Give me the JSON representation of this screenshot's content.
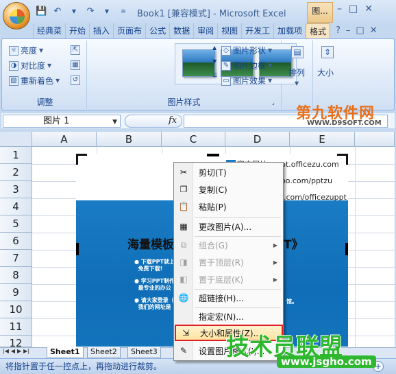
{
  "window": {
    "title": "Book1 [兼容模式] - Microsoft Excel",
    "context_tab_title": "图...",
    "window_buttons": [
      "–",
      "□",
      "✕"
    ]
  },
  "qat": {
    "icons": [
      "save-icon",
      "undo-icon",
      "redo-icon",
      "customize-icon"
    ]
  },
  "ribbon": {
    "tabs": [
      "经典菜",
      "开始",
      "插入",
      "页面布",
      "公式",
      "数据",
      "审阅",
      "视图",
      "开发工",
      "加载项",
      "格式"
    ],
    "active_tab": "格式",
    "help_icons": [
      "?",
      "–",
      "□",
      "✕"
    ],
    "groups": {
      "adjust": {
        "label": "调整",
        "brightness": "亮度",
        "contrast": "对比度",
        "recolor": "重新着色"
      },
      "picture_styles": {
        "label": "图片样式",
        "shape": "图片形状",
        "border": "图片边框",
        "effects": "图片效果"
      },
      "arrange": {
        "label": "排列"
      },
      "size": {
        "label": "大小"
      }
    }
  },
  "watermark_top": {
    "title": "第九软件网",
    "url": "WWW.D9SOFT.COM"
  },
  "formula_bar": {
    "name_box": "图片 1",
    "fx": "fx",
    "value": ""
  },
  "sheet": {
    "columns": [
      "A",
      "B",
      "C",
      "D",
      "E"
    ],
    "rows": [
      "1",
      "2",
      "3",
      "4",
      "5",
      "6",
      "7",
      "8",
      "9",
      "10",
      "11",
      "12"
    ]
  },
  "picture": {
    "top_lines": [
      "ppt.officezu.com",
      "eibo.com/pptzu",
      "qq.com/officezuppt"
    ],
    "top_line_prefix": "官方网址：",
    "heading_left": "海量模板",
    "heading_right": "T》",
    "bullets": [
      {
        "line1": "下载PPT就上",
        "line2": "免费下载!"
      },
      {
        "line1": "学习PPT制作",
        "line2": "最专业的办公"
      },
      {
        "line1": "请大家登录（",
        "line2": "我们的网址是"
      }
    ],
    "bullet_tail": "馆。"
  },
  "context_menu": {
    "items": [
      {
        "label": "剪切(T)",
        "icon": "scissors-icon",
        "glyph": "✂",
        "enabled": true
      },
      {
        "label": "复制(C)",
        "icon": "copy-icon",
        "glyph": "❐",
        "enabled": true
      },
      {
        "label": "粘贴(P)",
        "icon": "paste-icon",
        "glyph": "📋",
        "enabled": true
      },
      {
        "label": "更改图片(A)...",
        "icon": "change-picture-icon",
        "glyph": "▦",
        "enabled": true
      },
      {
        "label": "组合(G)",
        "icon": "group-icon",
        "glyph": "⧉",
        "enabled": false,
        "submenu": true
      },
      {
        "label": "置于顶层(R)",
        "icon": "bring-front-icon",
        "glyph": "◨",
        "enabled": false,
        "submenu": true
      },
      {
        "label": "置于底层(K)",
        "icon": "send-back-icon",
        "glyph": "◧",
        "enabled": false,
        "submenu": true
      },
      {
        "label": "超链接(H)...",
        "icon": "hyperlink-icon",
        "glyph": "🌐",
        "enabled": true
      },
      {
        "label": "指定宏(N)...",
        "icon": "macro-icon",
        "glyph": "",
        "enabled": true
      },
      {
        "label": "大小和属性(Z)...",
        "icon": "size-properties-icon",
        "glyph": "⇲",
        "enabled": true,
        "highlighted": true
      },
      {
        "label": "设置图片格式(I)...",
        "icon": "format-picture-icon",
        "glyph": "✎",
        "enabled": true
      }
    ]
  },
  "watermark_bottom": {
    "title": "技术员联盟",
    "url": "www.jsgho.com"
  },
  "sheet_tabs": [
    "Sheet1",
    "Sheet2",
    "Sheet3"
  ],
  "status_bar": {
    "text": "将指针置于任一控点上，再拖动进行裁剪。",
    "zoom_in": "+"
  }
}
